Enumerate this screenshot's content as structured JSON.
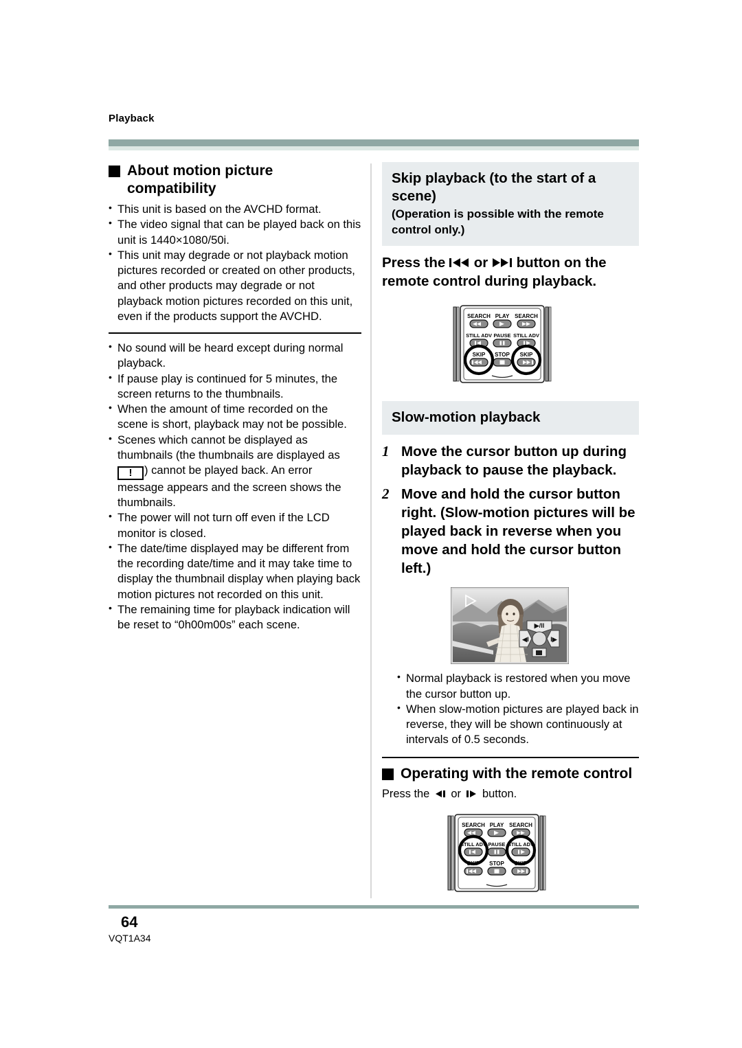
{
  "running_head": "Playback",
  "footer": {
    "page_number": "64",
    "doc_code": "VQT1A34"
  },
  "colors": {
    "rule_teal": "#8fa8a4",
    "rule_teal_light": "#dde8e4",
    "shade_gray": "#e8ecee",
    "divider": "#d8d8d8"
  },
  "left_column": {
    "heading": "About motion picture compatibility",
    "bullets_group1": [
      "This unit is based on the AVCHD format.",
      "The video signal that can be played back on this unit is 1440×1080/50i.",
      "This unit may degrade or not playback motion pictures recorded or created on other products, and other products may degrade or not playback motion pictures recorded on this unit, even if the products support the AVCHD."
    ],
    "bullets_group2": [
      "No sound will be heard except during normal playback.",
      "If pause play is continued for 5 minutes, the screen returns to the thumbnails.",
      "When the amount of time recorded on the scene is short, playback may not be possible.",
      "The power will not turn off even if the LCD monitor is closed.",
      "The date/time displayed may be different from the recording date/time and it may take time to display the thumbnail display when playing back motion pictures not recorded on this unit.",
      "The remaining time for playback indication will be reset to “0h00m00s” each scene."
    ],
    "thumbnail_bullet": {
      "part1": "Scenes which cannot be displayed as thumbnails (the thumbnails are displayed as",
      "glyph": "!",
      "part2": ") cannot be played back. An error message appears and the screen shows the thumbnails."
    }
  },
  "right_column": {
    "skip_section": {
      "title": "Skip playback (to the start of a scene)",
      "subtitle": "(Operation is possible with the remote control only.)",
      "instruction_pre": "Press the ",
      "instruction_icon1": "skip-back-icon",
      "instruction_mid": " or ",
      "instruction_icon2": "skip-forward-icon",
      "instruction_post": " button on the remote control during playback."
    },
    "slow_section": {
      "title": "Slow-motion playback",
      "steps": [
        {
          "num": "1",
          "text": "Move the cursor button up during playback to pause the playback."
        },
        {
          "num": "2",
          "text": "Move and hold the cursor button right. (Slow-motion pictures will be played back in reverse when you move and hold the cursor button left.)"
        }
      ],
      "notes": [
        "Normal playback is restored when you move the cursor button up.",
        "When slow-motion pictures are played back in reverse, they will be shown continuously at intervals of 0.5 seconds."
      ]
    },
    "remote_section": {
      "heading": "Operating with the remote control",
      "instruction_pre": "Press the ",
      "instruction_icon1": "still-adv-left-icon",
      "instruction_mid": " or ",
      "instruction_icon2": "still-adv-right-icon",
      "instruction_post": " button."
    }
  },
  "figures": {
    "remote_top": {
      "name": "remote-control-skip-diagram",
      "labels": {
        "search_left": "SEARCH",
        "play": "PLAY",
        "search_right": "SEARCH",
        "still_adv_left": "STILL ADV",
        "pause": "PAUSE",
        "still_adv_right": "STILL ADV",
        "skip_left": "SKIP",
        "stop": "STOP",
        "skip_right": "SKIP"
      },
      "highlighted": [
        "skip_left",
        "skip_right"
      ]
    },
    "remote_bottom": {
      "name": "remote-control-still-adv-diagram",
      "labels": {
        "search_left": "SEARCH",
        "play": "PLAY",
        "search_right": "SEARCH",
        "still_adv_left": "STILL ADV",
        "pause": "PAUSE",
        "still_adv_right": "STILL ADV",
        "skip_left": "SKIP",
        "stop": "STOP",
        "skip_right": "SKIP"
      },
      "highlighted": [
        "still_adv_left",
        "still_adv_right"
      ]
    },
    "lcd": {
      "name": "lcd-playback-screen",
      "overlay_icons": [
        "play-pause-icon",
        "slow-reverse-icon",
        "slow-forward-icon",
        "stop-icon",
        "record-dot-icon"
      ],
      "corner_icon": "play-indicator-icon"
    }
  }
}
